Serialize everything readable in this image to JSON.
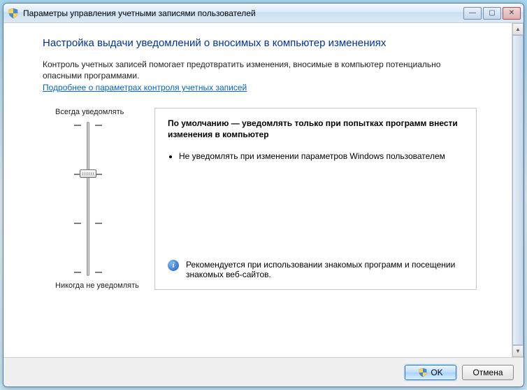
{
  "window": {
    "title": "Параметры управления учетными записями пользователей"
  },
  "page": {
    "heading": "Настройка выдачи уведомлений о вносимых в компьютер изменениях",
    "description": "Контроль учетных записей помогает предотвратить изменения, вносимые в компьютер потенциально опасными программами.",
    "help_link": "Подробнее о параметрах контроля учетных записей"
  },
  "slider": {
    "top_label": "Всегда уведомлять",
    "bottom_label": "Никогда не уведомлять",
    "levels": 4,
    "current_level": 2
  },
  "info": {
    "heading": "По умолчанию — уведомлять только при попытках программ внести изменения в компьютер",
    "bullets": [
      "Не уведомлять при изменении параметров Windows пользователем"
    ],
    "footer": "Рекомендуется при использовании знакомых программ и посещении знакомых веб-сайтов."
  },
  "buttons": {
    "ok": "OK",
    "cancel": "Отмена"
  }
}
